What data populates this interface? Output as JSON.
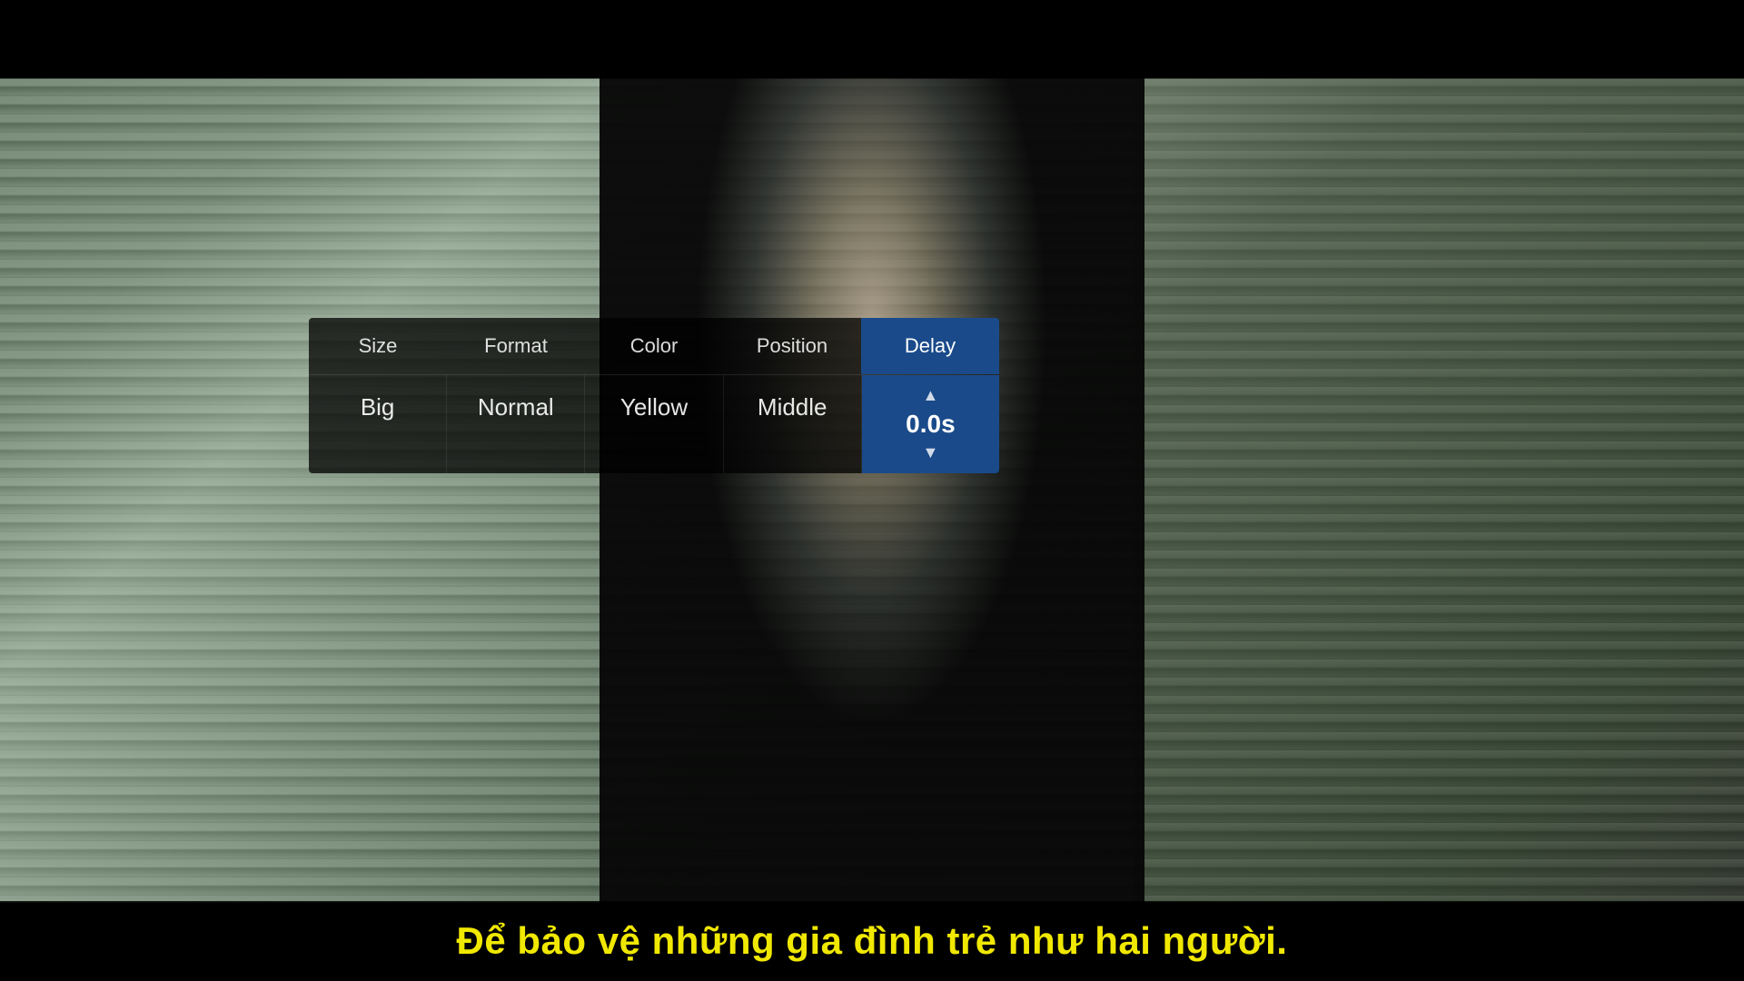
{
  "scene": {
    "subtitle": "Để bảo vệ những gia đình trẻ như hai người."
  },
  "settings": {
    "columns": [
      {
        "label": "Size",
        "value": "Big"
      },
      {
        "label": "Format",
        "value": "Normal"
      },
      {
        "label": "Color",
        "value": "Yellow"
      },
      {
        "label": "Position",
        "value": "Middle"
      },
      {
        "label": "Delay",
        "value": "0.0s"
      }
    ],
    "active_column": "Delay"
  },
  "colors": {
    "subtitle_yellow": "#f0e800",
    "active_blue": "#1a4a8a",
    "panel_bg": "rgba(0,0,0,0.75)"
  },
  "icons": {
    "arrow_up": "▲",
    "arrow_down": "▼",
    "chevron_up": "^",
    "chevron_down": "v"
  }
}
